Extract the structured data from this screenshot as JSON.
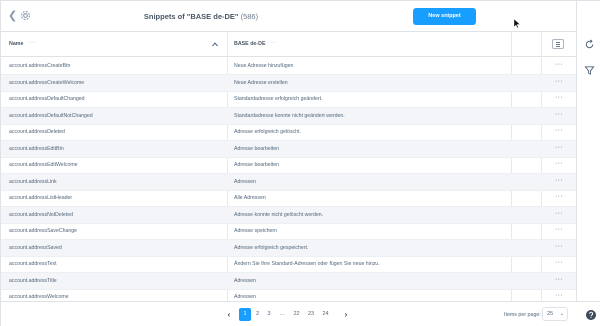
{
  "header": {
    "title": "Snippets of \"BASE de-DE\"",
    "count": "(586)",
    "new_button": "New snippet"
  },
  "grid": {
    "columns": {
      "name": "Name",
      "value": "BASE de-DE"
    },
    "rows": [
      {
        "name": "account.addressCreateBtn",
        "value": "Neue Adresse hinzufügen"
      },
      {
        "name": "account.addressCreateWelcome",
        "value": "Neue Adresse erstellen"
      },
      {
        "name": "account.addressDefaultChanged",
        "value": "Standardadresse erfolgreich geändert."
      },
      {
        "name": "account.addressDefaultNotChanged",
        "value": "Standardadresse konnte nicht geändert werden."
      },
      {
        "name": "account.addressDeleted",
        "value": "Adresse erfolgreich gelöscht."
      },
      {
        "name": "account.addressEditBtn",
        "value": "Adresse bearbeiten"
      },
      {
        "name": "account.addressEditWelcome",
        "value": "Adresse bearbeiten"
      },
      {
        "name": "account.addressLink",
        "value": "Adressen"
      },
      {
        "name": "account.addressListHeader",
        "value": "Alle Adressen"
      },
      {
        "name": "account.addressNotDeleted",
        "value": "Adresse konnte nicht gelöscht werden."
      },
      {
        "name": "account.addressSaveChange",
        "value": "Adresse speichern"
      },
      {
        "name": "account.addressSaved",
        "value": "Adresse erfolgreich gespeichert."
      },
      {
        "name": "account.addressText",
        "value": "Ändern Sie Ihre Standard-Adressen oder fügen Sie neue hinzu."
      },
      {
        "name": "account.addressTitle",
        "value": "Adressen"
      },
      {
        "name": "account.addressWelcome",
        "value": "Adressen"
      }
    ]
  },
  "pagination": {
    "pages": [
      "1",
      "2",
      "3",
      "...",
      "22",
      "23",
      "24"
    ],
    "active": "1",
    "items_per_page_label": "Items per page:",
    "items_per_page": "25"
  },
  "colors": {
    "accent": "#189eff",
    "row_alt": "#f3f5f8",
    "text": "#52667a"
  }
}
